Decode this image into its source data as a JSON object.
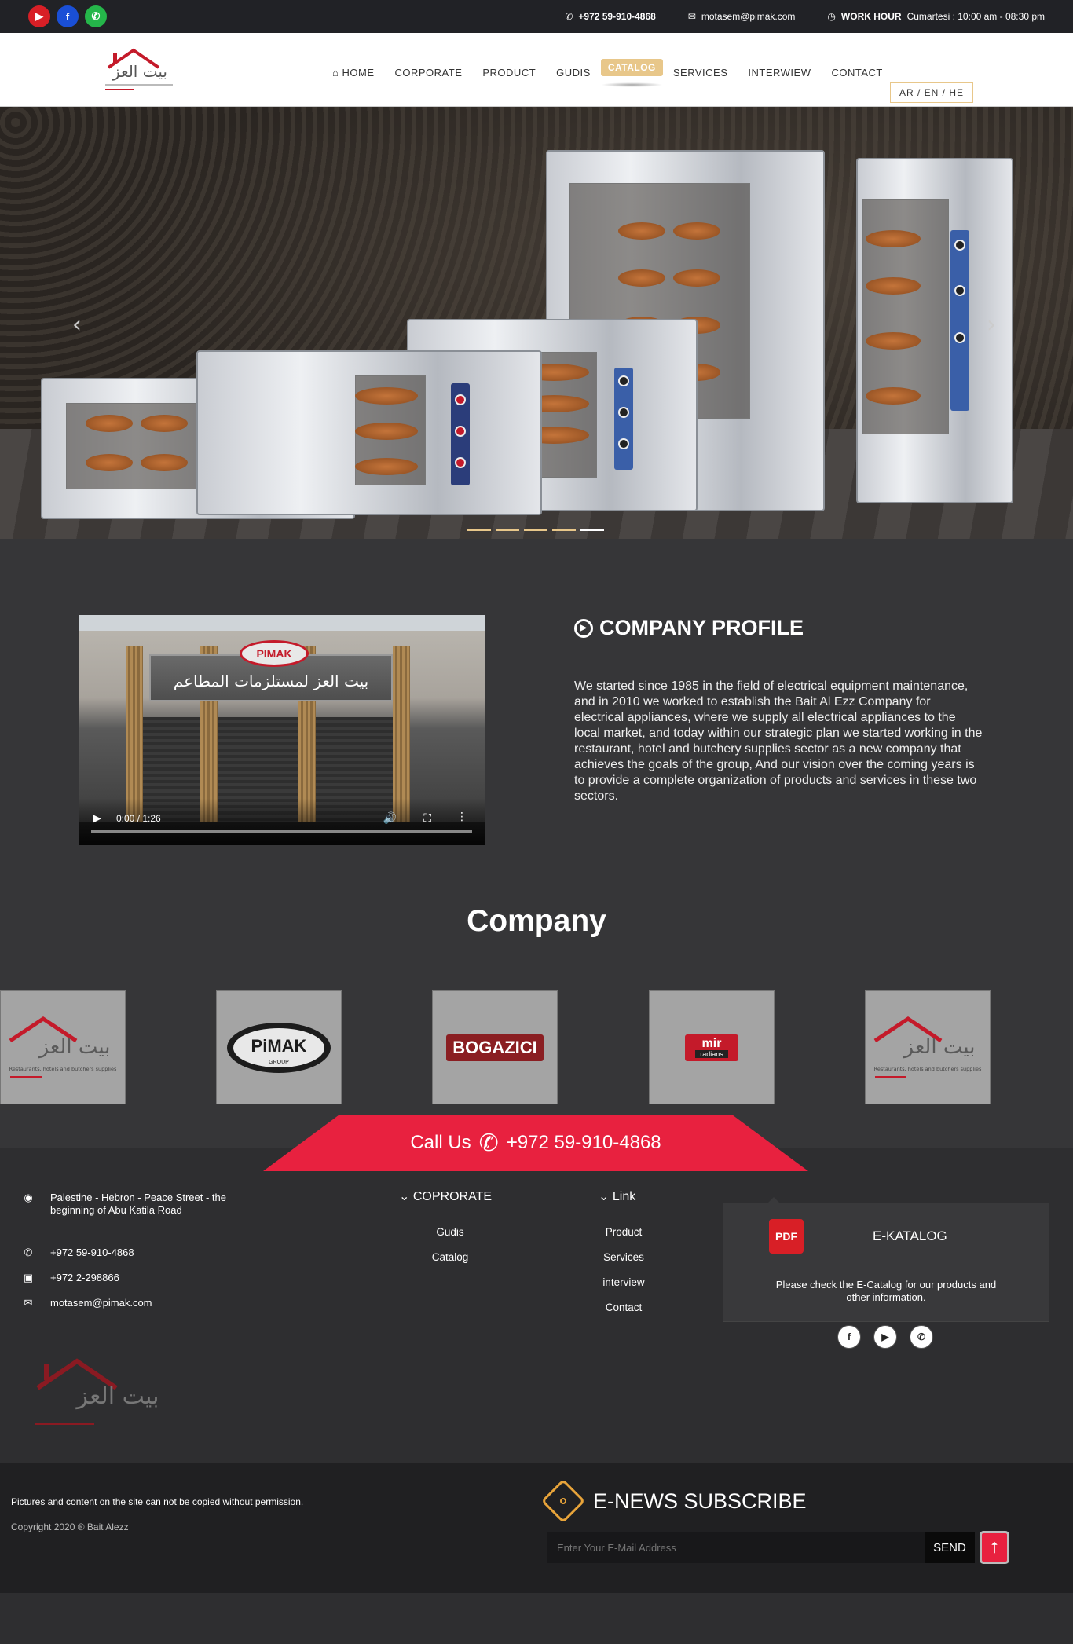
{
  "topbar": {
    "phone": "+972 59-910-4868",
    "email": "motasem@pimak.com",
    "work_hour_label": "WORK HOUR",
    "work_hour_value": "Cumartesi : 10:00 am - 08:30 pm",
    "social": [
      {
        "icon": "youtube-icon",
        "glyph": "▶",
        "color": "#d81f26"
      },
      {
        "icon": "facebook-icon",
        "glyph": "f",
        "color": "#1a4fd6"
      },
      {
        "icon": "whatsapp-icon",
        "glyph": "✆",
        "color": "#25b64a"
      }
    ]
  },
  "nav": {
    "items": [
      {
        "label": "HOME",
        "icon": "home-icon"
      },
      {
        "label": "CORPORATE"
      },
      {
        "label": "PRODUCT"
      },
      {
        "label": "GUDIS"
      },
      {
        "label": "CATALOG",
        "active": true
      },
      {
        "label": "SERVICES"
      },
      {
        "label": "INTERWIEW"
      },
      {
        "label": "CONTACT"
      }
    ],
    "lang": "AR / EN / HE"
  },
  "hero": {
    "slides": 5,
    "active_slide": 5
  },
  "profile": {
    "title": "COMPANY PROFILE",
    "text": "We started since 1985 in the field of electrical equipment maintenance, and in 2010 we worked to establish the Bait Al Ezz Company for electrical appliances, where we supply all electrical appliances to the local market, and today within our strategic plan we started working in the restaurant, hotel and butchery supplies sector as a new company that achieves the goals of the group, And our vision over the coming years is to provide a complete organization of products and services in these two sectors.",
    "video_time": "0:00 / 1:26",
    "video_sign_text": "بيت العز لمستلزمات المطاعم",
    "video_sign_logo": "PIMAK"
  },
  "company": {
    "title": "Company",
    "brands": [
      {
        "name": "بيت العز",
        "sub": "Restaurants, hotels and butchers supplies"
      },
      {
        "name": "PiMAK",
        "sub": "GROUP"
      },
      {
        "name": "BOGAZICI",
        "sub": ""
      },
      {
        "name": "mir",
        "sub": "radians"
      },
      {
        "name": "بيت العز",
        "sub": "Restaurants, hotels and butchers supplies"
      }
    ]
  },
  "callus": {
    "label": "Call Us",
    "phone": "+972 59-910-4868"
  },
  "footer": {
    "address": "Palestine - Hebron - Peace Street - the beginning of Abu Katila Road",
    "phone1": "+972 59-910-4868",
    "phone2": "+972 2-298866",
    "email": "motasem@pimak.com",
    "logo_text": "بيت العز",
    "corporate_title": "COPRORATE",
    "corporate_links": [
      "Gudis",
      "Catalog"
    ],
    "link_title": "Link",
    "links": [
      "Product",
      "Services",
      "interview",
      "Contact"
    ],
    "ekatalog": {
      "title": "E-KATALOG",
      "desc": "Please check the E-Catalog for our products and other information."
    },
    "social": [
      {
        "icon": "facebook-icon",
        "glyph": "f"
      },
      {
        "icon": "youtube-icon",
        "glyph": "▶"
      },
      {
        "icon": "whatsapp-icon",
        "glyph": "✆"
      }
    ]
  },
  "bottom": {
    "notice": "Pictures and content on the site can not be copied without permission.",
    "copyright": "Copyright 2020 ® Bait Alezz",
    "news_title": "E-NEWS SUBSCRIBE",
    "email_placeholder": "Enter Your E-Mail Address",
    "send_label": "SEND"
  }
}
